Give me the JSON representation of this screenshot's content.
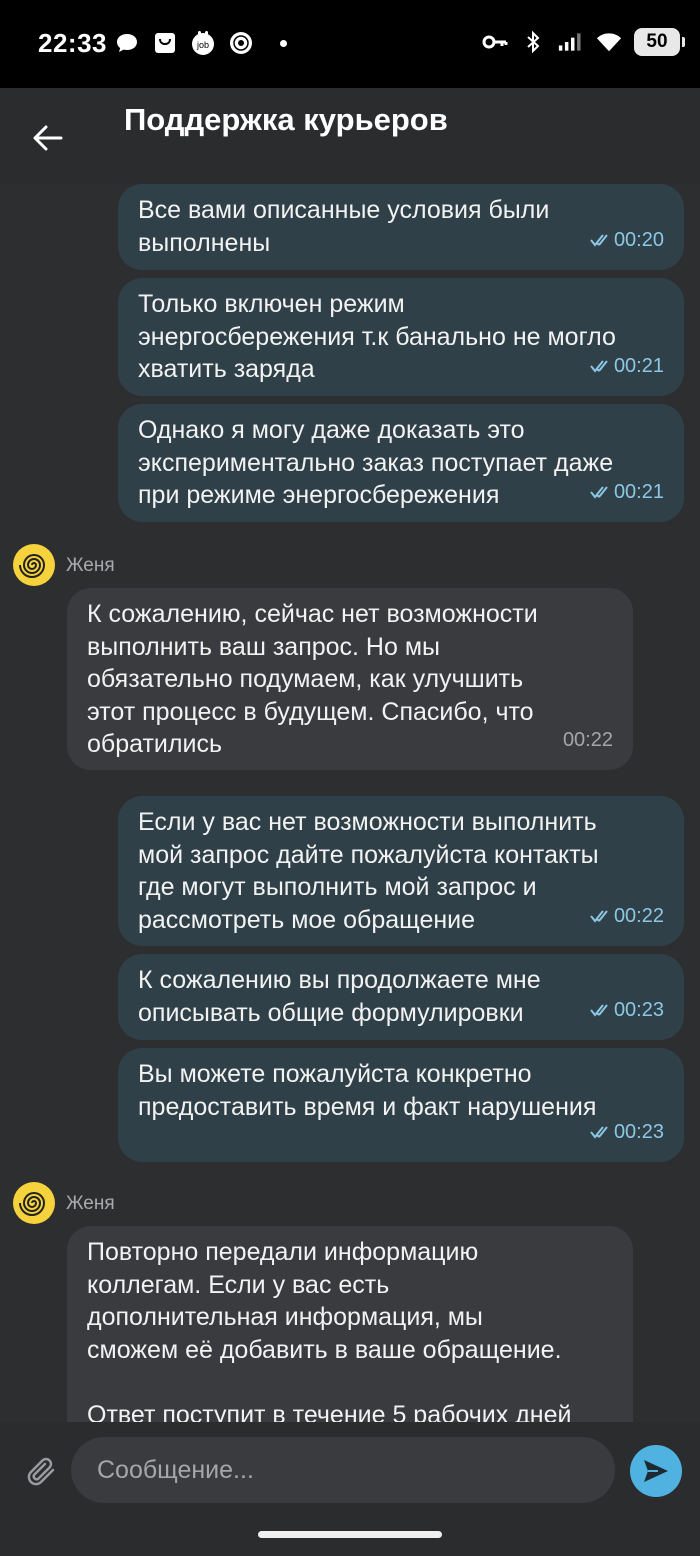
{
  "status_bar": {
    "time": "22:33",
    "left_icons": [
      "chat-bubble-icon",
      "shopping-bag-icon",
      "job-app-icon",
      "shield-app-icon"
    ],
    "right_icons": [
      "key-icon",
      "bluetooth-icon",
      "signal-icon",
      "wifi-icon"
    ],
    "battery": "50"
  },
  "header": {
    "back_icon": "arrow-left-icon",
    "title": "Поддержка курьеров"
  },
  "messages": [
    {
      "direction": "out",
      "text": "Все вами описанные условия были\nвыполнены",
      "time": "00:20",
      "read": true
    },
    {
      "direction": "out",
      "text": "Только включен режим\nэнергосбережения т.к банально не могло\nхватить заряда",
      "time": "00:21",
      "read": true
    },
    {
      "direction": "out",
      "text": "Однако я могу даже доказать это\nэкспериментально заказ поступает даже\nпри режиме энергосбережения",
      "time": "00:21",
      "read": true
    },
    {
      "direction": "in",
      "sender": "Женя",
      "text": "К сожалению, сейчас нет возможности\nвыполнить ваш запрос. Но мы\nобязательно подумаем, как улучшить\nэтот процесс в будущем. Спасибо, что\nобратились",
      "time": "00:22"
    },
    {
      "direction": "out",
      "text": "Если у вас нет возможности выполнить\nмой запрос дайте пожалуйста контакты\nгде могут выполнить мой запрос и\nрассмотреть мое обращение",
      "time": "00:22",
      "read": true
    },
    {
      "direction": "out",
      "text": "К сожалению вы продолжаете мне\nописывать общие формулировки",
      "time": "00:23",
      "read": true
    },
    {
      "direction": "out",
      "text": "Вы можете пожалуйста конкретно\nпредоставить время и факт нарушения",
      "time": "00:23",
      "read": true
    },
    {
      "direction": "in",
      "sender": "Женя",
      "text": "Повторно передали информацию\nколлегам. Если у вас есть\nдополнительная информация, мы\nсможем её добавить в ваше обращение.\n\nОтвет поступит в течение 5 рабочих дней",
      "time": ""
    }
  ],
  "composer": {
    "placeholder": "Сообщение...",
    "attach_icon": "paperclip-icon",
    "send_icon": "send-icon"
  },
  "colors": {
    "background": "#2d2e30",
    "outgoing_bubble": "#2f4048",
    "incoming_bubble": "#3a3b3f",
    "read_tick": "#8cc7e6",
    "send_button": "#4fb2e0",
    "avatar": "#f6d33c"
  }
}
